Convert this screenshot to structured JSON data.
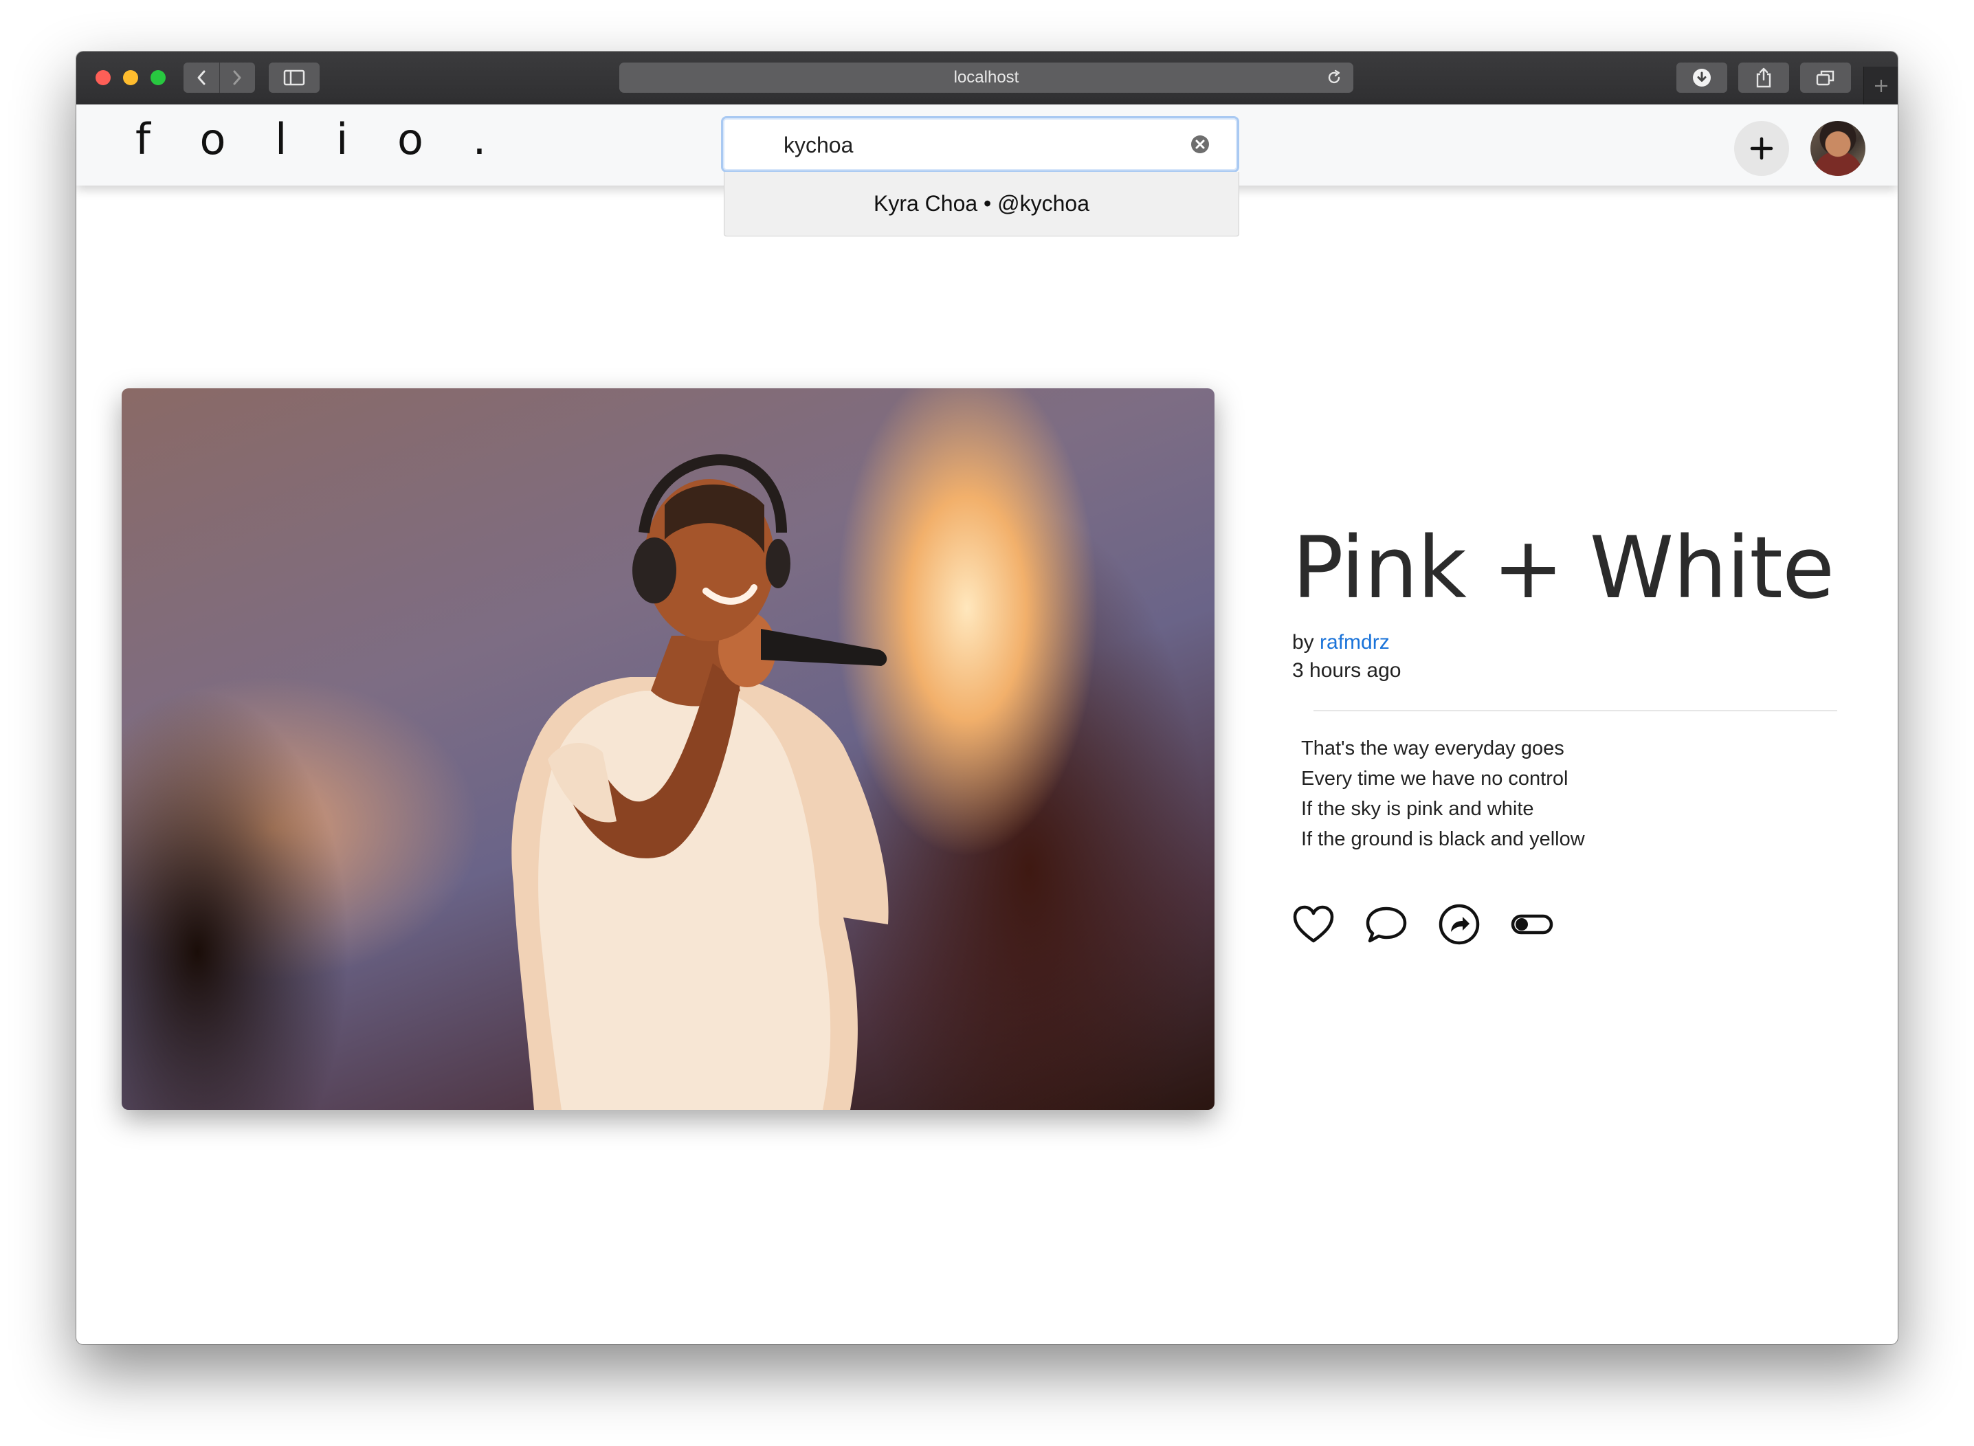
{
  "browser": {
    "url": "localhost"
  },
  "header": {
    "logo": "f o l i o .",
    "search": {
      "value": "kychoa",
      "placeholder": ""
    },
    "suggestion": "Kyra Choa • @kychoa"
  },
  "post": {
    "title": "Pink + White",
    "by_label": "by",
    "author": "rafmdrz",
    "time": "3 hours ago",
    "lines": [
      "That's the way everyday goes",
      "Every time we have no control",
      "If the sky is pink and white",
      "If the ground is black and yellow"
    ]
  },
  "colors": {
    "link": "#1a73d9",
    "search_focus": "#a9c9f2",
    "toolbar": "#3b3b3d"
  },
  "icons": {
    "actions": [
      "heart-icon",
      "comment-icon",
      "share-icon",
      "toggle-icon"
    ]
  }
}
